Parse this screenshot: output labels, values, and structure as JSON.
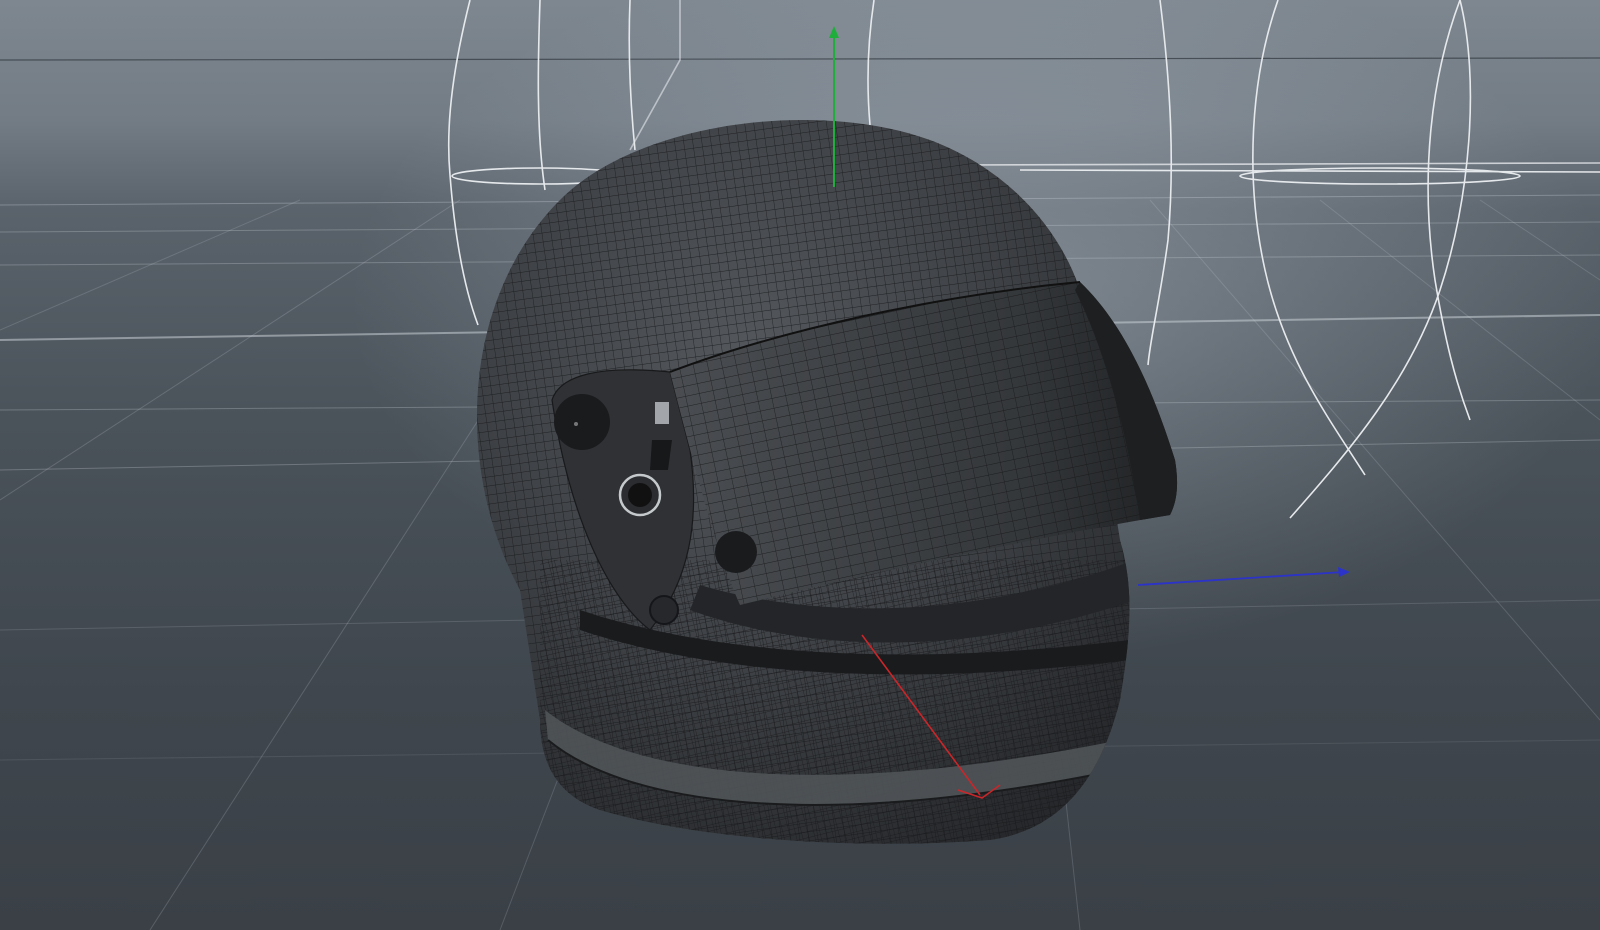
{
  "viewport": {
    "view_type": "perspective-3d-viewport",
    "display_mode": "wireframe-on-shaded",
    "background_top": "#7e8790",
    "background_bottom": "#3a4046"
  },
  "scene": {
    "object": "helmet-mesh",
    "object_color": "#3b3d40",
    "wire_color": "#1a1b1d",
    "visor_color": "#2e3033",
    "lights": [
      {
        "name": "area-light-left"
      },
      {
        "name": "area-light-right"
      }
    ],
    "light_color": "#e6e9ec"
  },
  "gizmo": {
    "axes": [
      {
        "axis": "y",
        "color": "#1fae3c"
      },
      {
        "axis": "x",
        "color": "#2b33c9"
      },
      {
        "axis": "z",
        "color": "#c9262a"
      }
    ]
  },
  "grid": {
    "color": "#c9cfd6"
  }
}
